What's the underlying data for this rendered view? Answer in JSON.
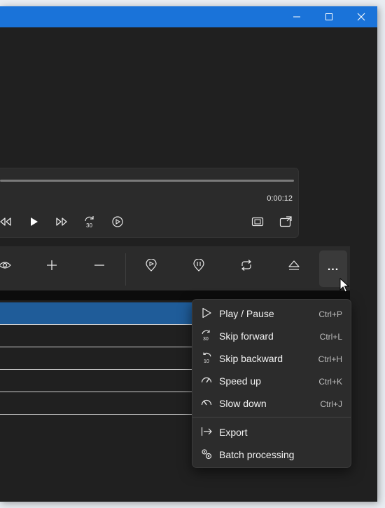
{
  "window": {
    "titlebar_color": "#1a73d9",
    "controls": [
      "minimize-icon",
      "maximize-icon",
      "close-icon"
    ]
  },
  "player": {
    "time": "0:00:12",
    "controls": [
      "skip-back-icon",
      "play-icon",
      "fast-forward-icon",
      "skip-forward-30-icon",
      "replay-icon",
      "fit-screen-icon",
      "popout-icon"
    ]
  },
  "toolbar": {
    "tools": [
      "eye-icon",
      "plus-icon",
      "minus-icon",
      "marker-in-icon",
      "marker-out-icon",
      "loop-icon",
      "eject-icon"
    ],
    "more_label": "..."
  },
  "menu": {
    "items": [
      {
        "icon": "play-icon",
        "label": "Play / Pause",
        "shortcut": "Ctrl+P"
      },
      {
        "icon": "skip-forward-30-icon",
        "label": "Skip forward",
        "shortcut": "Ctrl+L"
      },
      {
        "icon": "skip-back-10-icon",
        "label": "Skip backward",
        "shortcut": "Ctrl+H"
      },
      {
        "icon": "speed-up-icon",
        "label": "Speed up",
        "shortcut": "Ctrl+K"
      },
      {
        "icon": "slow-down-icon",
        "label": "Slow down",
        "shortcut": "Ctrl+J"
      },
      {
        "icon": "export-icon",
        "label": "Export",
        "shortcut": ""
      },
      {
        "icon": "batch-icon",
        "label": "Batch processing",
        "shortcut": ""
      }
    ]
  },
  "colors": {
    "accent": "#1a73d9",
    "selected_row": "#1f5c99",
    "menu_bg": "#2c2c2c"
  }
}
